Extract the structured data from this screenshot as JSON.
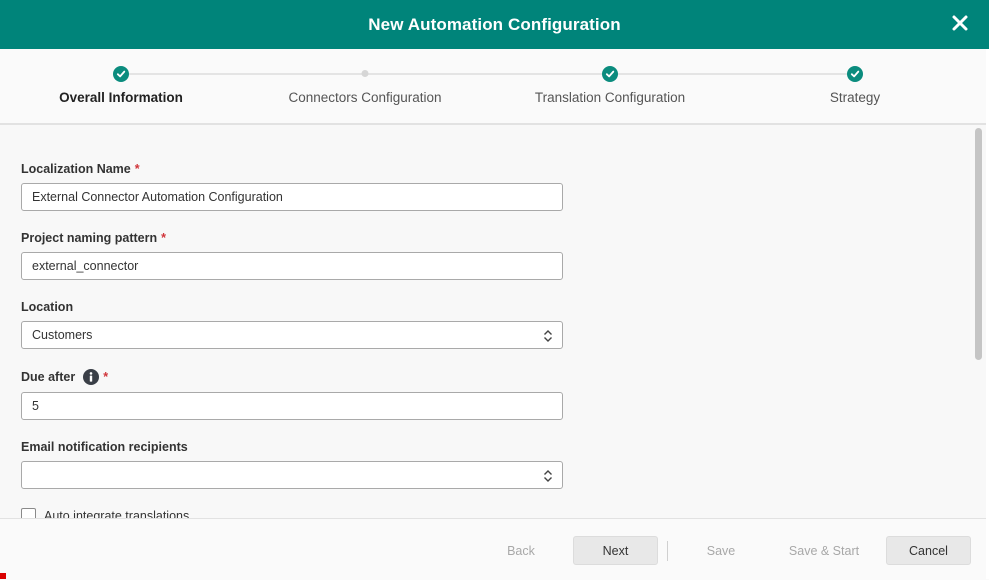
{
  "header": {
    "title": "New Automation Configuration",
    "close_icon": "close-icon",
    "background": "#00847a"
  },
  "stepper": {
    "steps": [
      {
        "label": "Overall Information",
        "state": "done",
        "active": true
      },
      {
        "label": "Connectors Configuration",
        "state": "pending",
        "active": false
      },
      {
        "label": "Translation Configuration",
        "state": "done",
        "active": false
      },
      {
        "label": "Strategy",
        "state": "done",
        "active": false
      }
    ],
    "done_color": "#0b8c7e"
  },
  "form": {
    "localization_name": {
      "label": "Localization Name",
      "required_mark": "*",
      "value": "External Connector Automation Configuration"
    },
    "project_naming_pattern": {
      "label": "Project naming pattern",
      "required_mark": "*",
      "value": "external_connector"
    },
    "location": {
      "label": "Location",
      "value": "Customers"
    },
    "due_after": {
      "label": "Due after",
      "required_mark": "*",
      "value": "5",
      "info_icon": "info-icon"
    },
    "email_recipients": {
      "label": "Email notification recipients",
      "value": ""
    },
    "auto_integrate": {
      "label": "Auto integrate translations",
      "checked": false
    }
  },
  "footer": {
    "back": "Back",
    "next": "Next",
    "save": "Save",
    "save_start": "Save & Start",
    "cancel": "Cancel"
  }
}
